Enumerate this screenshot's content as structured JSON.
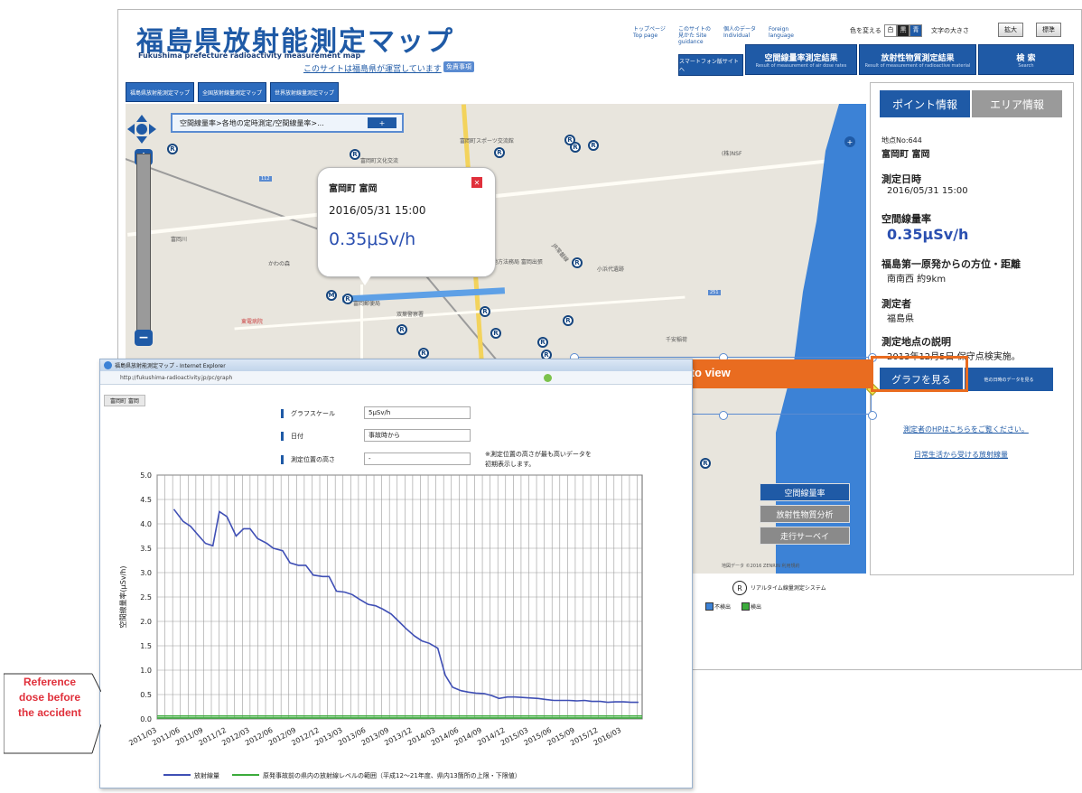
{
  "site": {
    "title": "福島県放射能測定マップ",
    "subtitle": "Fukushima prefecture radioactivity measurement map",
    "notice": "このサイトは福島県が運営しています",
    "notice_badge": "免責事項",
    "top_links": [
      "トップページ Top page",
      "このサイトの見かた Site guidance",
      "個人のデータ Individual",
      "Foreign language"
    ],
    "color_label": "色を変える",
    "color_options": [
      "白",
      "黒",
      "青"
    ],
    "fontsize_label": "文字の大きさ",
    "fontsize_buttons": [
      "拡大",
      "標準"
    ],
    "smartphone_button": "スマートフォン版サイトへ",
    "nav_tabs": [
      {
        "label": "空間線量率測定結果",
        "sub": "Result of measurement of air dose rates"
      },
      {
        "label": "放射性物質測定結果",
        "sub": "Result of measurement of radioactive material"
      },
      {
        "label": "検 索",
        "sub": "Search"
      }
    ],
    "map_tabs": [
      "福島県放射能測定マップ",
      "全国放射線量測定マップ",
      "世界放射線量測定マップ"
    ]
  },
  "map": {
    "breadcrumb": "空間線量率>各地の定時測定/空間線量率>...",
    "breadcrumb_button": "+",
    "labels": {
      "sports": "富岡町スポーツ交流館",
      "culture": "富岡町文化交流",
      "river": "富岡川",
      "kawanomori": "かわの森",
      "office": "福島地方法務局 富岡出張所",
      "post": "富岡郵便局",
      "bank": "双葉警察署",
      "elementary": "東電病院",
      "kobama": "小浜代遺跡",
      "chiba": "千安稲荷",
      "route6": "6",
      "route112": "112",
      "route251": "251",
      "jr": "JR常磐線",
      "hospital": "(株)NSF"
    },
    "popup": {
      "place": "富岡町 富岡",
      "time": "2016/05/31 15:00",
      "value": "0.35μSv/h"
    },
    "legend_buttons": [
      "空間線量率",
      "放射性物質分析",
      "走行サーベイ"
    ],
    "copyright": "地図データ ©2016 ZENRIN 利用規約"
  },
  "info": {
    "tabs": [
      "ポイント情報",
      "エリア情報"
    ],
    "point_no": "地点No:644",
    "point_name": "富岡町 富岡",
    "time_label": "測定日時",
    "time_value": "2016/05/31 15:00",
    "dose_label": "空間線量率",
    "dose_value": "0.35μSv/h",
    "dist_label": "福島第一原発からの方位・距離",
    "dist_value": "南南西 約9km",
    "measurer_label": "測定者",
    "measurer_value": "福島県",
    "desc_label": "測定地点の説明",
    "desc_value": "2013年12月5日 保守点検実施。",
    "graph_button": "グラフを見る",
    "other_button": "他の日時のデータを見る",
    "link1": "測定者のHPはこちらをご覧ください。",
    "link2": "日常生活から受ける放射線量"
  },
  "map_legend": {
    "realtime": "リアルタイム線量測定システム",
    "not_detected": "不検出",
    "detected": "検出"
  },
  "callout": {
    "text": "Click to view"
  },
  "ie": {
    "title": "福島県放射能測定マップ - Internet Explorer",
    "address": "http://fukushima-radioactivity.jp/pc/graph",
    "point": "富岡町 富岡",
    "controls": [
      {
        "label": "グラフスケール",
        "value": "5μSv/h"
      },
      {
        "label": "日付",
        "value": "事故時から"
      },
      {
        "label": "測定位置の高さ",
        "value": "-"
      }
    ],
    "note": "※測定位置の高さが最も高いデータを初期表示します。"
  },
  "reference": {
    "text": "Reference dose before the accident"
  },
  "chart_data": {
    "type": "line",
    "title": "",
    "xlabel": "",
    "ylabel": "空間線量率(μSv/h)",
    "ylim": [
      0,
      5.0
    ],
    "yticks": [
      "0.0",
      "0.5",
      "1.0",
      "1.5",
      "2.0",
      "2.5",
      "3.0",
      "3.5",
      "4.0",
      "4.5",
      "5.0"
    ],
    "xticks": [
      "2011/03",
      "2011/06",
      "2011/09",
      "2011/12",
      "2012/03",
      "2012/06",
      "2012/09",
      "2012/12",
      "2013/03",
      "2013/06",
      "2013/09",
      "2013/12",
      "2014/03",
      "2014/06",
      "2014/09",
      "2014/12",
      "2015/03",
      "2015/06",
      "2015/09",
      "2015/12",
      "2016/03"
    ],
    "grid": true,
    "legend_position": "bottom",
    "series": [
      {
        "name": "放射線量",
        "color": "#3f4fb5",
        "x": [
          2011.38,
          2011.48,
          2011.56,
          2011.65,
          2011.72,
          2011.8,
          2011.87,
          2011.95,
          2012.05,
          2012.13,
          2012.2,
          2012.28,
          2012.38,
          2012.45,
          2012.55,
          2012.63,
          2012.72,
          2012.8,
          2012.88,
          2012.98,
          2013.05,
          2013.13,
          2013.22,
          2013.3,
          2013.38,
          2013.47,
          2013.55,
          2013.63,
          2013.72,
          2013.8,
          2013.88,
          2013.97,
          2014.05,
          2014.13,
          2014.22,
          2014.3,
          2014.38,
          2014.47,
          2014.55,
          2014.63,
          2014.72,
          2014.8,
          2014.88,
          2014.97,
          2015.05,
          2015.13,
          2015.22,
          2015.3,
          2015.38,
          2015.47,
          2015.55,
          2015.63,
          2015.72,
          2015.8,
          2015.88,
          2015.97,
          2016.05,
          2016.13,
          2016.22,
          2016.3,
          2016.38
        ],
        "values": [
          4.3,
          4.05,
          3.95,
          3.75,
          3.6,
          3.55,
          4.25,
          4.15,
          3.75,
          3.9,
          3.9,
          3.7,
          3.6,
          3.5,
          3.45,
          3.2,
          3.15,
          3.15,
          2.95,
          2.92,
          2.92,
          2.62,
          2.6,
          2.55,
          2.45,
          2.35,
          2.32,
          2.25,
          2.15,
          2.0,
          1.85,
          1.7,
          1.6,
          1.55,
          1.45,
          0.9,
          0.65,
          0.58,
          0.55,
          0.53,
          0.52,
          0.48,
          0.42,
          0.45,
          0.45,
          0.44,
          0.43,
          0.42,
          0.4,
          0.38,
          0.38,
          0.38,
          0.37,
          0.38,
          0.36,
          0.36,
          0.34,
          0.35,
          0.35,
          0.34,
          0.34
        ]
      },
      {
        "name": "原発事故前の県内の放射線レベルの範囲（平成12〜21年度、県内13箇所の上限・下限値）",
        "color": "#3cab3c",
        "range": [
          0.02,
          0.06
        ]
      }
    ]
  }
}
